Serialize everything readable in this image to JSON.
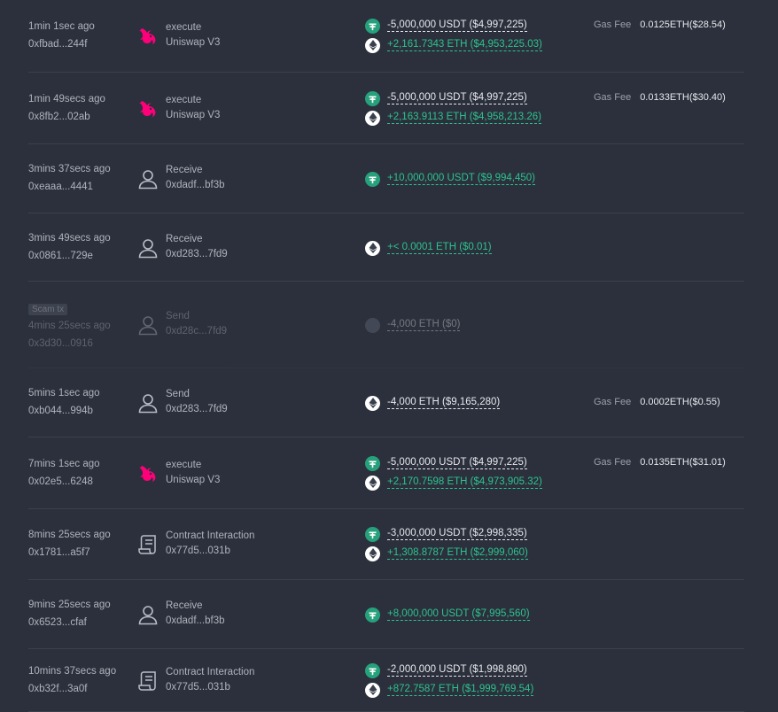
{
  "colors": {
    "background": "#2b303c",
    "positive": "#2ec28e",
    "negative": "#e6e8ec",
    "uniswap": "#ff007a",
    "usdt": "#26a17b"
  },
  "gas_label": "Gas Fee",
  "rows": [
    {
      "time": "1min 1sec ago",
      "hash": "0xfbad...244f",
      "icon": "uniswap-icon",
      "action": "execute",
      "target": "Uniswap V3",
      "tokens": [
        {
          "icon": "usdt-icon",
          "amount": "-5,000,000 USDT ($4,997,225)"
        },
        {
          "icon": "eth-icon",
          "amount": "+2,161.7343 ETH ($4,953,225.03)"
        }
      ],
      "gas": "0.0125ETH($28.54)"
    },
    {
      "time": "1min 49secs ago",
      "hash": "0x8fb2...02ab",
      "icon": "uniswap-icon",
      "action": "execute",
      "target": "Uniswap V3",
      "tokens": [
        {
          "icon": "usdt-icon",
          "amount": "-5,000,000 USDT ($4,997,225)"
        },
        {
          "icon": "eth-icon",
          "amount": "+2,163.9113 ETH ($4,958,213.26)"
        }
      ],
      "gas": "0.0133ETH($30.40)"
    },
    {
      "time": "3mins 37secs ago",
      "hash": "0xeaaa...4441",
      "icon": "user-icon",
      "action": "Receive",
      "target": "0xdadf...bf3b",
      "tokens": [
        {
          "icon": "usdt-icon",
          "amount": "+10,000,000 USDT ($9,994,450)"
        }
      ]
    },
    {
      "time": "3mins 49secs ago",
      "hash": "0x0861...729e",
      "icon": "user-icon",
      "action": "Receive",
      "target": "0xd283...7fd9",
      "tokens": [
        {
          "icon": "eth-icon",
          "amount": "+< 0.0001 ETH ($0.01)"
        }
      ]
    },
    {
      "tag": "Scam tx",
      "time": "4mins 25secs ago",
      "hash": "0x3d30...0916",
      "icon": "user-icon",
      "action": "Send",
      "target": "0xd28c...7fd9",
      "tokens": [
        {
          "icon": "unknown-token-icon",
          "amount": "-4,000 ETH ($0)"
        }
      ]
    },
    {
      "time": "5mins 1sec ago",
      "hash": "0xb044...994b",
      "icon": "user-icon",
      "action": "Send",
      "target": "0xd283...7fd9",
      "tokens": [
        {
          "icon": "eth-icon",
          "amount": "-4,000 ETH ($9,165,280)"
        }
      ],
      "gas": "0.0002ETH($0.55)"
    },
    {
      "time": "7mins 1sec ago",
      "hash": "0x02e5...6248",
      "icon": "uniswap-icon",
      "action": "execute",
      "target": "Uniswap V3",
      "tokens": [
        {
          "icon": "usdt-icon",
          "amount": "-5,000,000 USDT ($4,997,225)"
        },
        {
          "icon": "eth-icon",
          "amount": "+2,170.7598 ETH ($4,973,905.32)"
        }
      ],
      "gas": "0.0135ETH($31.01)"
    },
    {
      "time": "8mins 25secs ago",
      "hash": "0x1781...a5f7",
      "icon": "contract-icon",
      "action": "Contract Interaction",
      "target": "0x77d5...031b",
      "tokens": [
        {
          "icon": "usdt-icon",
          "amount": "-3,000,000 USDT ($2,998,335)"
        },
        {
          "icon": "eth-icon",
          "amount": "+1,308.8787 ETH ($2,999,060)"
        }
      ]
    },
    {
      "time": "9mins 25secs ago",
      "hash": "0x6523...cfaf",
      "icon": "user-icon",
      "action": "Receive",
      "target": "0xdadf...bf3b",
      "tokens": [
        {
          "icon": "usdt-icon",
          "amount": "+8,000,000 USDT ($7,995,560)"
        }
      ]
    },
    {
      "time": "10mins 37secs ago",
      "hash": "0xb32f...3a0f",
      "icon": "contract-icon",
      "action": "Contract Interaction",
      "target": "0x77d5...031b",
      "tokens": [
        {
          "icon": "usdt-icon",
          "amount": "-2,000,000 USDT ($1,998,890)"
        },
        {
          "icon": "eth-icon",
          "amount": "+872.7587 ETH ($1,999,769.54)"
        }
      ]
    }
  ]
}
